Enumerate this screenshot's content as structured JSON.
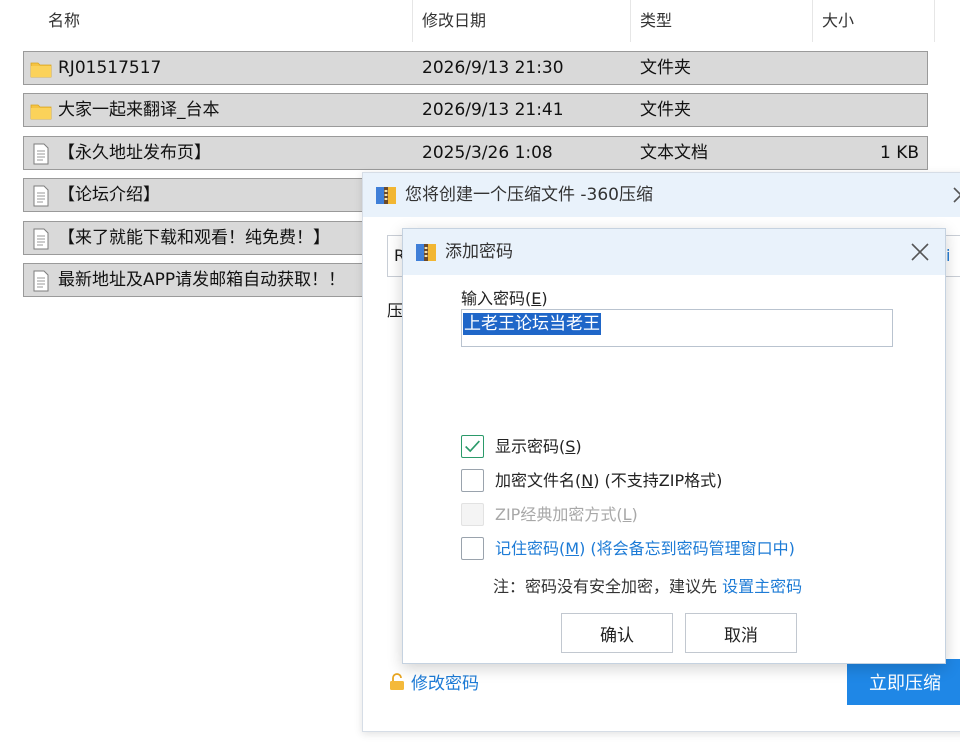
{
  "explorer": {
    "columns": {
      "name": "名称",
      "modified": "修改日期",
      "type": "类型",
      "size": "大小"
    },
    "sort_indicator": "^",
    "files": [
      {
        "icon": "folder-icon",
        "name": "RJ01517517",
        "modified": "2026/9/13 21:30",
        "type": "文件夹",
        "size": ""
      },
      {
        "icon": "folder-icon",
        "name": "大家一起来翻译_台本",
        "modified": "2026/9/13 21:41",
        "type": "文件夹",
        "size": ""
      },
      {
        "icon": "text-file-icon",
        "name": "【永久地址发布页】",
        "modified": "2025/3/26 1:08",
        "type": "文本文档",
        "size": "1 KB"
      },
      {
        "icon": "text-file-icon",
        "name": "【论坛介绍】",
        "modified": "",
        "type": "",
        "size": ""
      },
      {
        "icon": "text-file-icon",
        "name": "【来了就能下载和观看！纯免费！】",
        "modified": "",
        "type": "",
        "size": ""
      },
      {
        "icon": "text-file-icon",
        "name": "最新地址及APP请发邮箱自动获取！！",
        "modified": "",
        "type": "",
        "size": ""
      }
    ]
  },
  "compress_dialog": {
    "title": "您将创建一个压缩文件 -360压缩",
    "path_value": "R",
    "path_suffix": "i",
    "label": "压",
    "change_password_link": "修改密码",
    "compress_button": "立即压缩"
  },
  "password_dialog": {
    "title": "添加密码",
    "password_label": "输入密码(E)",
    "password_label_main": "输入密码(",
    "password_label_key": "E",
    "password_label_end": ")",
    "password_value": "上老王论坛当老王",
    "options": [
      {
        "label_main": "显示密码(",
        "key": "S",
        "label_end": ")",
        "checked": true,
        "disabled": false
      },
      {
        "label_main": "加密文件名(",
        "key": "N",
        "label_end": ") (不支持ZIP格式)",
        "checked": false,
        "disabled": false
      },
      {
        "label_main": "ZIP经典加密方式(",
        "key": "L",
        "label_end": ")",
        "checked": false,
        "disabled": true
      },
      {
        "label_main": "记住密码(",
        "key": "M",
        "label_end": ") (将会备忘到密码管理窗口中)",
        "checked": false,
        "disabled": false
      }
    ],
    "note_text": "注：密码没有安全加密，建议先 ",
    "note_link": "设置主密码",
    "ok_button": "确认",
    "cancel_button": "取消"
  },
  "colors": {
    "accent": "#1f87e6",
    "link": "#1d7bd6",
    "selection": "#1f66c8",
    "title_bar": "#e9f2fb",
    "checked": "#2b9a6a",
    "folder": "#f5c342"
  }
}
